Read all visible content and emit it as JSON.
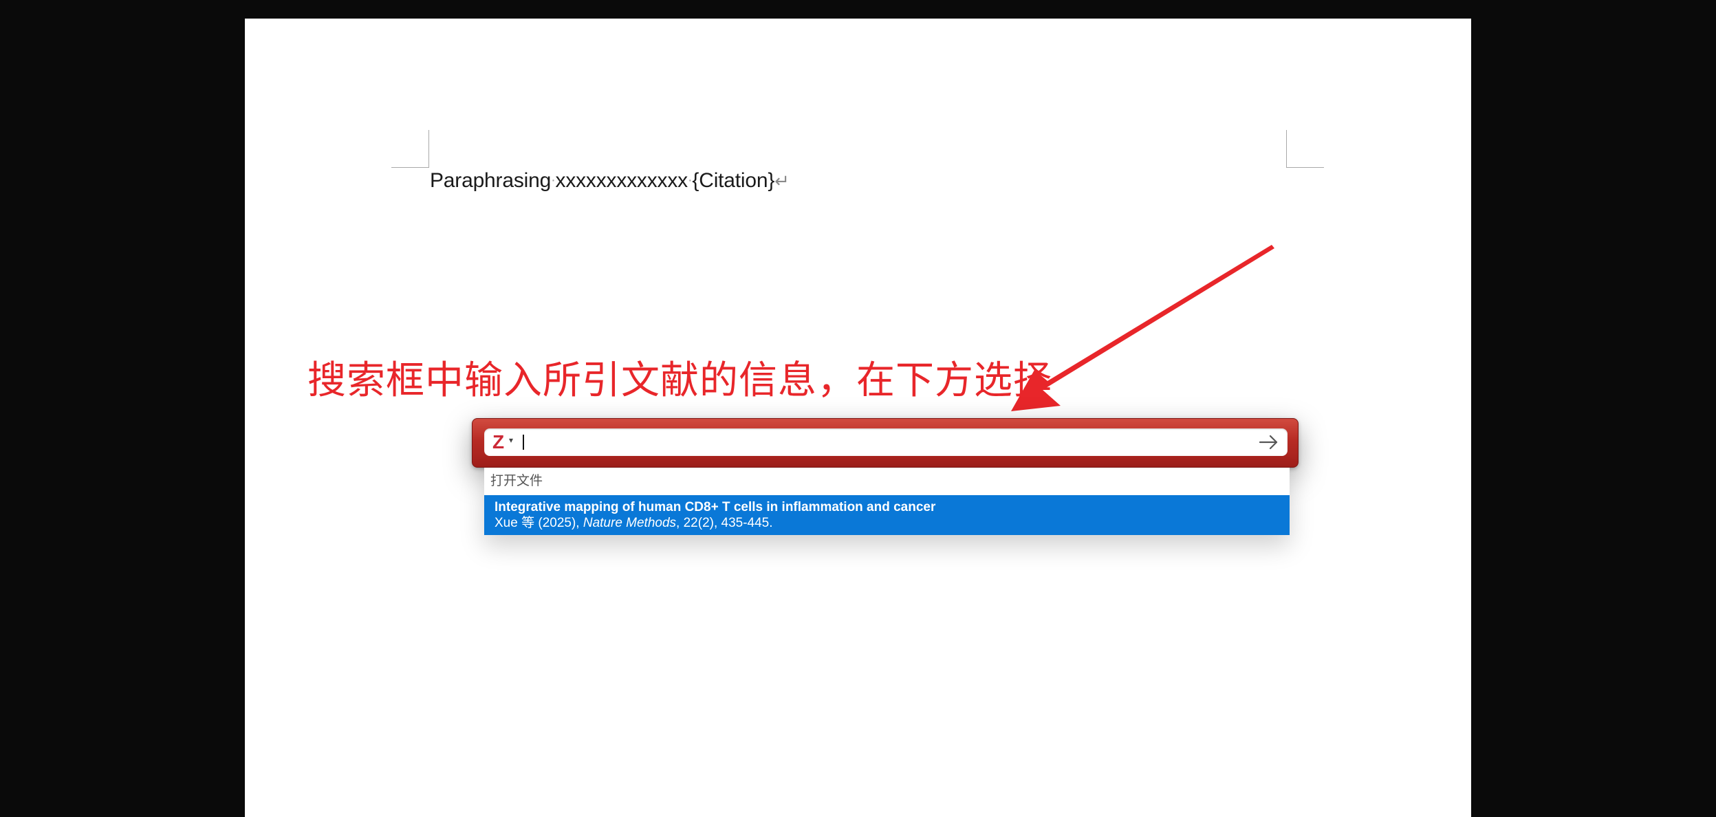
{
  "document": {
    "text_word1": "Paraphrasing",
    "text_word2": "xxxxxxxxxxxxx",
    "text_citation": "{Citation}",
    "paragraph_mark": "↵",
    "space_mark": "·"
  },
  "annotation": {
    "text": "搜索框中输入所引文献的信息，在下方选择",
    "color": "#e8262a"
  },
  "zotero_search": {
    "logo": "Z",
    "logo_dropdown": "▾",
    "input_value": "",
    "go_icon": "arrow-right-icon",
    "bar_color": "#b72b24"
  },
  "results": {
    "section_header": "打开文件",
    "items": [
      {
        "title": "Integrative mapping of human CD8+ T cells in inflammation and cancer",
        "authors": "Xue 等 (2025), ",
        "journal": "Nature Methods",
        "details": ", 22(2), 435-445.",
        "selected": true,
        "highlight_color": "#0a78d7"
      }
    ]
  }
}
